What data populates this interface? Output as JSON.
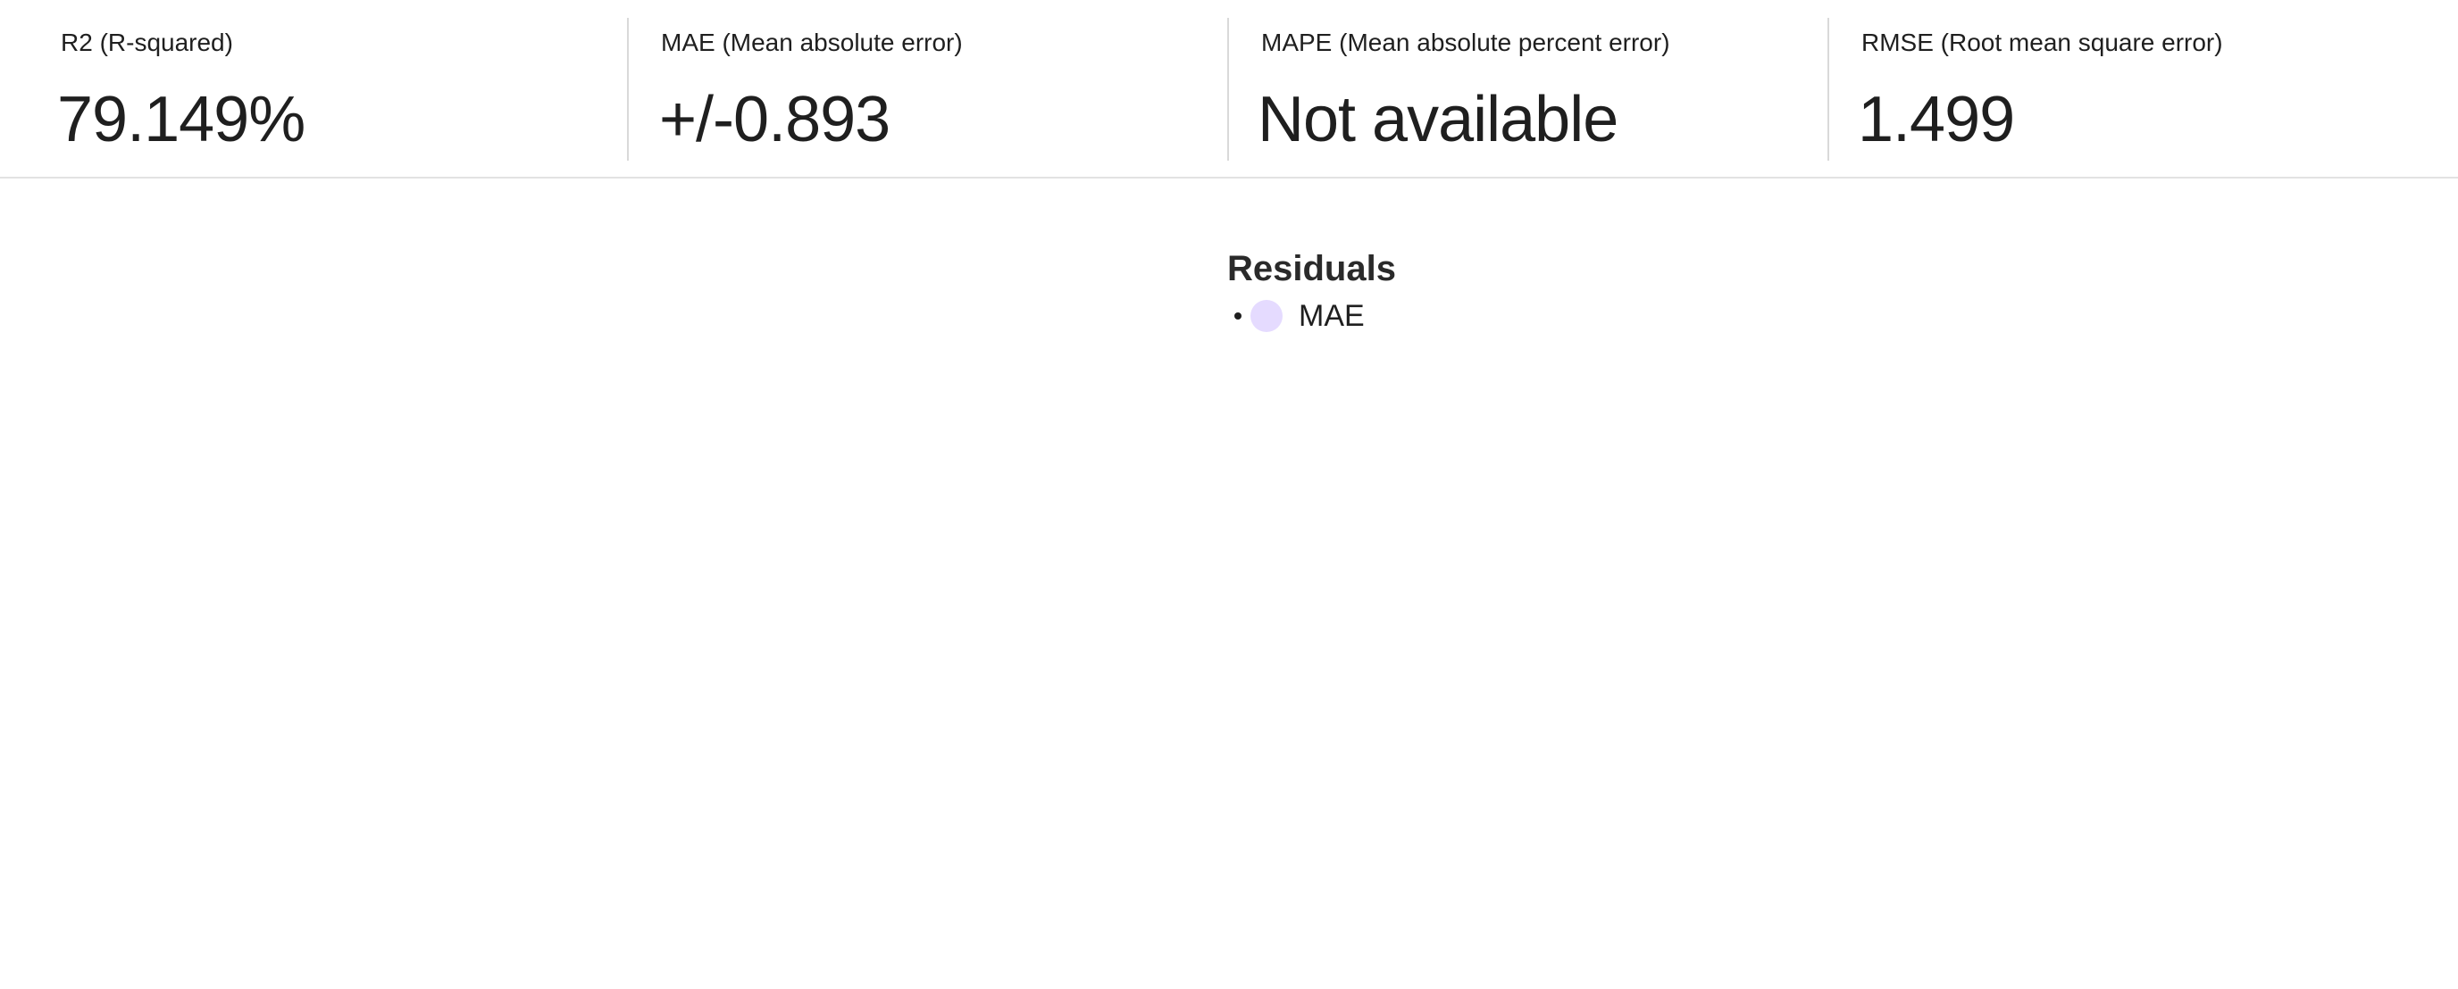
{
  "metrics": [
    {
      "label": "R2 (R-squared)",
      "value": "79.149%"
    },
    {
      "label": "MAE (Mean absolute error)",
      "value": "+/-0.893"
    },
    {
      "label": "MAPE (Mean absolute percent error)",
      "value": "Not available"
    },
    {
      "label": "RMSE (Root mean square error)",
      "value": "1.499"
    }
  ],
  "residuals": {
    "title": "Residuals",
    "legend": [
      {
        "label": "MAE",
        "color": "#e5dbff"
      }
    ]
  }
}
